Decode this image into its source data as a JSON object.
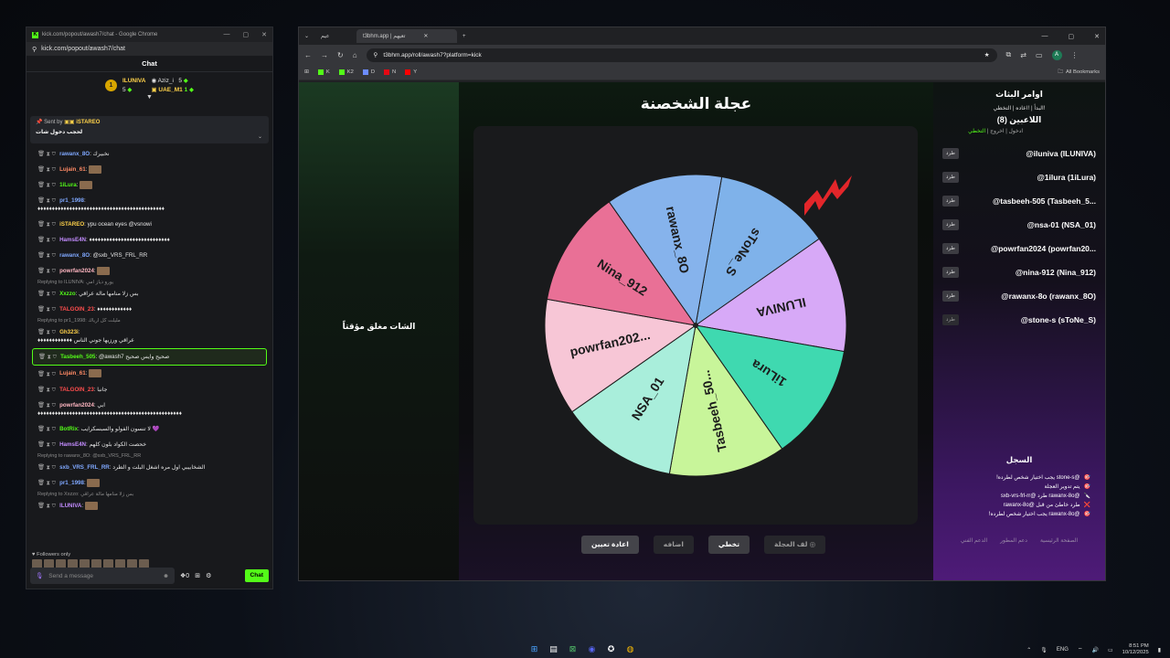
{
  "chat_window": {
    "title": "kick.com/popout/awash7/chat - Google Chrome",
    "url": "kick.com/popout/awash7/chat",
    "header": "Chat",
    "leaders": [
      {
        "rank": "1",
        "name": "ILUNIVA",
        "value": "5"
      },
      {
        "name": "Aziz_i",
        "value": "5"
      },
      {
        "name": "UAE_M1",
        "value": "1"
      }
    ],
    "pinned": {
      "label": "Sent by",
      "user": "iSTAREO",
      "text": "لحجب دخول شات"
    },
    "messages": [
      {
        "user": "rawanx_8O",
        "text": "نخبيرك",
        "color": "#7fa8ff"
      },
      {
        "user": "Lujain_61",
        "text": "",
        "color": "#ff8a65",
        "emote": true
      },
      {
        "user": "1iLura",
        "text": "",
        "color": "#53fc18",
        "emote": true
      },
      {
        "user": "pr1_1998",
        "text": "",
        "color": "#7fa8ff",
        "long": "♦♦♦♦♦♦♦♦♦♦♦♦♦♦♦♦♦♦♦♦♦♦♦♦♦♦♦♦♦♦♦♦♦♦♦♦♦♦♦♦♦♦♦♦"
      },
      {
        "user": "iSTAREO",
        "text": "ypu ocean eyes @vsnowi",
        "color": "#ffd24a"
      },
      {
        "user": "HamsE4N",
        "text": "♦♦♦♦♦♦♦♦♦♦♦♦♦♦♦♦♦♦♦♦♦♦♦♦♦♦♦♦",
        "color": "#c38cff"
      },
      {
        "user": "rawanx_8O",
        "text": "@sxb_VRS_FRL_RR",
        "color": "#7fa8ff"
      },
      {
        "user": "powrfan2024",
        "text": "",
        "color": "#ffb6c1",
        "emote": true
      },
      {
        "reply": "Replying to ILUNIVA: يورو دياز امي",
        "user": "Xxzzo",
        "text": "بس زلا منامها مالة عراقي",
        "color": "#53fc18"
      },
      {
        "user": "TALGOIN_23",
        "text": "♦♦♦♦♦♦♦♦♦♦♦♦",
        "color": "#ff4d4d"
      },
      {
        "reply": "Replying to pr1_1998: مليلت كل ارياك",
        "user": "Gh323i",
        "text": "",
        "color": "#ffd24a",
        "long": "♦♦♦♦♦♦♦♦♦♦♦♦ عراقي ورزيها جوني الناس"
      },
      {
        "user": "Tasbeeh_505",
        "text": "@awash7 صحيح وايس صحيح",
        "color": "#53fc18",
        "highlight": true
      },
      {
        "user": "Lujain_61",
        "text": "",
        "color": "#ff8a65",
        "emote": true
      },
      {
        "user": "TALGOIN_23",
        "text": "جانبا",
        "color": "#ff4d4d"
      },
      {
        "user": "powrfan2024",
        "text": "ابي",
        "color": "#ffb6c1",
        "long": "♦♦♦♦♦♦♦♦♦♦♦♦♦♦♦♦♦♦♦♦♦♦♦♦♦♦♦♦♦♦♦♦♦♦♦♦♦♦♦♦♦♦♦♦♦♦♦♦♦♦"
      },
      {
        "user": "BotRix",
        "text": "لا تنسون الفولو والسبسكرايب 💜",
        "color": "#53fc18"
      },
      {
        "user": "HamsE4N",
        "text": "خحصت الكواد بلون كلهم",
        "color": "#c38cff"
      },
      {
        "reply": "Replying to rawanx_8O: @sxb_VRS_FRL_RR",
        "user": "sxb_VRS_FRL_RR",
        "text": "الشخابيبي اول مره اشغل البلت و الطرد",
        "color": "#7fa8ff"
      },
      {
        "user": "pr1_1998",
        "text": "",
        "color": "#7fa8ff",
        "emote": true
      },
      {
        "reply": "Replying to Xxzzo: بس زلا منامها مالة عراقي",
        "user": "ILUNIVA",
        "text": "",
        "color": "#c38cff",
        "emote": true
      }
    ],
    "followers_only": "Followers only",
    "send_placeholder": "Send a message",
    "chat_button": "Chat",
    "points": "0"
  },
  "browser": {
    "tabs": [
      "عيم",
      "t3bhm.app | تعيهم"
    ],
    "url": "t3bhm.app/roll/awash7?platform=kick",
    "bookmarks": [
      "K",
      "K2",
      "D",
      "N",
      "Y"
    ],
    "all_bookmarks": "All Bookmarks",
    "avatar": "A"
  },
  "page": {
    "closed_notice": "الشات مغلق مؤقتاً",
    "wheel_title": "عجلة الشخصنة",
    "buttons": {
      "spin": "لف العجلة",
      "skip": "تخطي",
      "add": "اضافه",
      "reset": "اعادة تعيين"
    },
    "commands_title": "اوامر البثاث",
    "commands_sub": "!البدأ | !اعاده | التخطي",
    "players_title": "اللاعبين (8)",
    "player_links": {
      "join": "ادخول",
      "leave": "اخروج",
      "skip": "التخطي"
    },
    "kick_label": "طرد",
    "players": [
      "@iluniva (ILUNIVA)",
      "@1ilura (1iLura)",
      "@tasbeeh-505 (Tasbeeh_5...",
      "@nsa-01 (NSA_01)",
      "@powrfan2024 (powrfan20...",
      "@nina-912 (Nina_912)",
      "@rawanx-8o (rawanx_8O)",
      "@stone-s (sToNe_S)"
    ],
    "log_title": "السجل",
    "log": [
      {
        "icon": "🎯",
        "text": "@stone-s يجب اختيار شخص لطرده!"
      },
      {
        "icon": "🎯",
        "text": "يتم تدوير العجلة"
      },
      {
        "icon": "🔪",
        "text": "@rawanx-8o طرد @sxb-vrs-frl-rr"
      },
      {
        "icon": "❌",
        "text": "طرد خاطئ من قبل @rawanx-8o"
      },
      {
        "icon": "🎯",
        "text": "@rawanx-8o يجب اختيار شخص لطرده!"
      }
    ],
    "footer": [
      "الصفحة الرئيسية",
      "دعم المطور",
      "الدعم الفني"
    ],
    "wheel_segments": [
      {
        "label": "sToNe_S",
        "color": "#7fb2ea"
      },
      {
        "label": "ILUNIVA",
        "color": "#d7a9f7"
      },
      {
        "label": "1iLura",
        "color": "#3fd9b0"
      },
      {
        "label": "Tasbeeh_50...",
        "color": "#c8f59a"
      },
      {
        "label": "NSA_01",
        "color": "#a9eedb"
      },
      {
        "label": "powrfan202...",
        "color": "#f7c6d6"
      },
      {
        "label": "Nina_912",
        "color": "#e97096"
      },
      {
        "label": "rawanx_8O",
        "color": "#86b3ec"
      }
    ]
  },
  "taskbar": {
    "lang": "ENG",
    "time": "8:51 PM",
    "date": "10/12/2025"
  }
}
